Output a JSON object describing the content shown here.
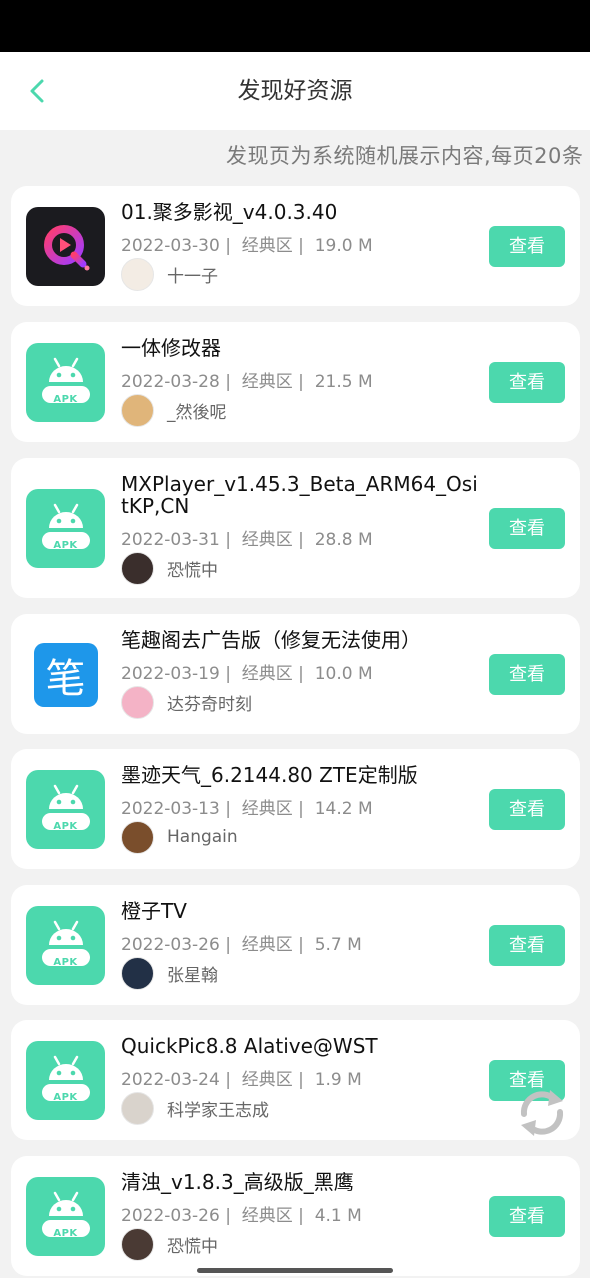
{
  "header": {
    "title": "发现好资源",
    "back_icon": "chevron-left-icon"
  },
  "notice": "发现页为系统随机展示内容,每页20条",
  "colors": {
    "accent": "#4cd8ad",
    "background": "#f2f2f2",
    "card": "#ffffff"
  },
  "view_label": "查看",
  "items": [
    {
      "name": "01.聚多影视_v4.0.3.40",
      "date": "2022-03-30",
      "zone": "经典区",
      "size": "19.0 M",
      "user": "十一子",
      "icon": "jutuo-video-app-icon"
    },
    {
      "name": "一体修改器",
      "date": "2022-03-28",
      "zone": "经典区",
      "size": "21.5 M",
      "user": "_然後呢",
      "icon": "apk-android-icon"
    },
    {
      "name": "MXPlayer_v1.45.3_Beta_ARM64_OsitKP,CN",
      "date": "2022-03-31",
      "zone": "经典区",
      "size": "28.8 M",
      "user": "恐慌中",
      "icon": "apk-android-icon"
    },
    {
      "name": "笔趣阁去广告版（修复无法使用）",
      "date": "2022-03-19",
      "zone": "经典区",
      "size": "10.0 M",
      "user": "达芬奇时刻",
      "icon": "biquge-pen-app-icon",
      "glyph": "笔"
    },
    {
      "name": "墨迹天气_6.2144.80 ZTE定制版",
      "date": "2022-03-13",
      "zone": "经典区",
      "size": "14.2 M",
      "user": "Hangain",
      "icon": "apk-android-icon"
    },
    {
      "name": "橙子TV",
      "date": "2022-03-26",
      "zone": "经典区",
      "size": "5.7 M",
      "user": "张星翰",
      "icon": "apk-android-icon"
    },
    {
      "name": "QuickPic8.8 Alative@WST",
      "date": "2022-03-24",
      "zone": "经典区",
      "size": "1.9 M",
      "user": "科学家王志成",
      "icon": "apk-android-icon"
    },
    {
      "name": "清浊_v1.8.3_高级版_黑鹰",
      "date": "2022-03-26",
      "zone": "经典区",
      "size": "4.1 M",
      "user": "恐慌中",
      "icon": "apk-android-icon"
    }
  ],
  "apk_label": "APK",
  "fab_icon": "refresh-icon"
}
